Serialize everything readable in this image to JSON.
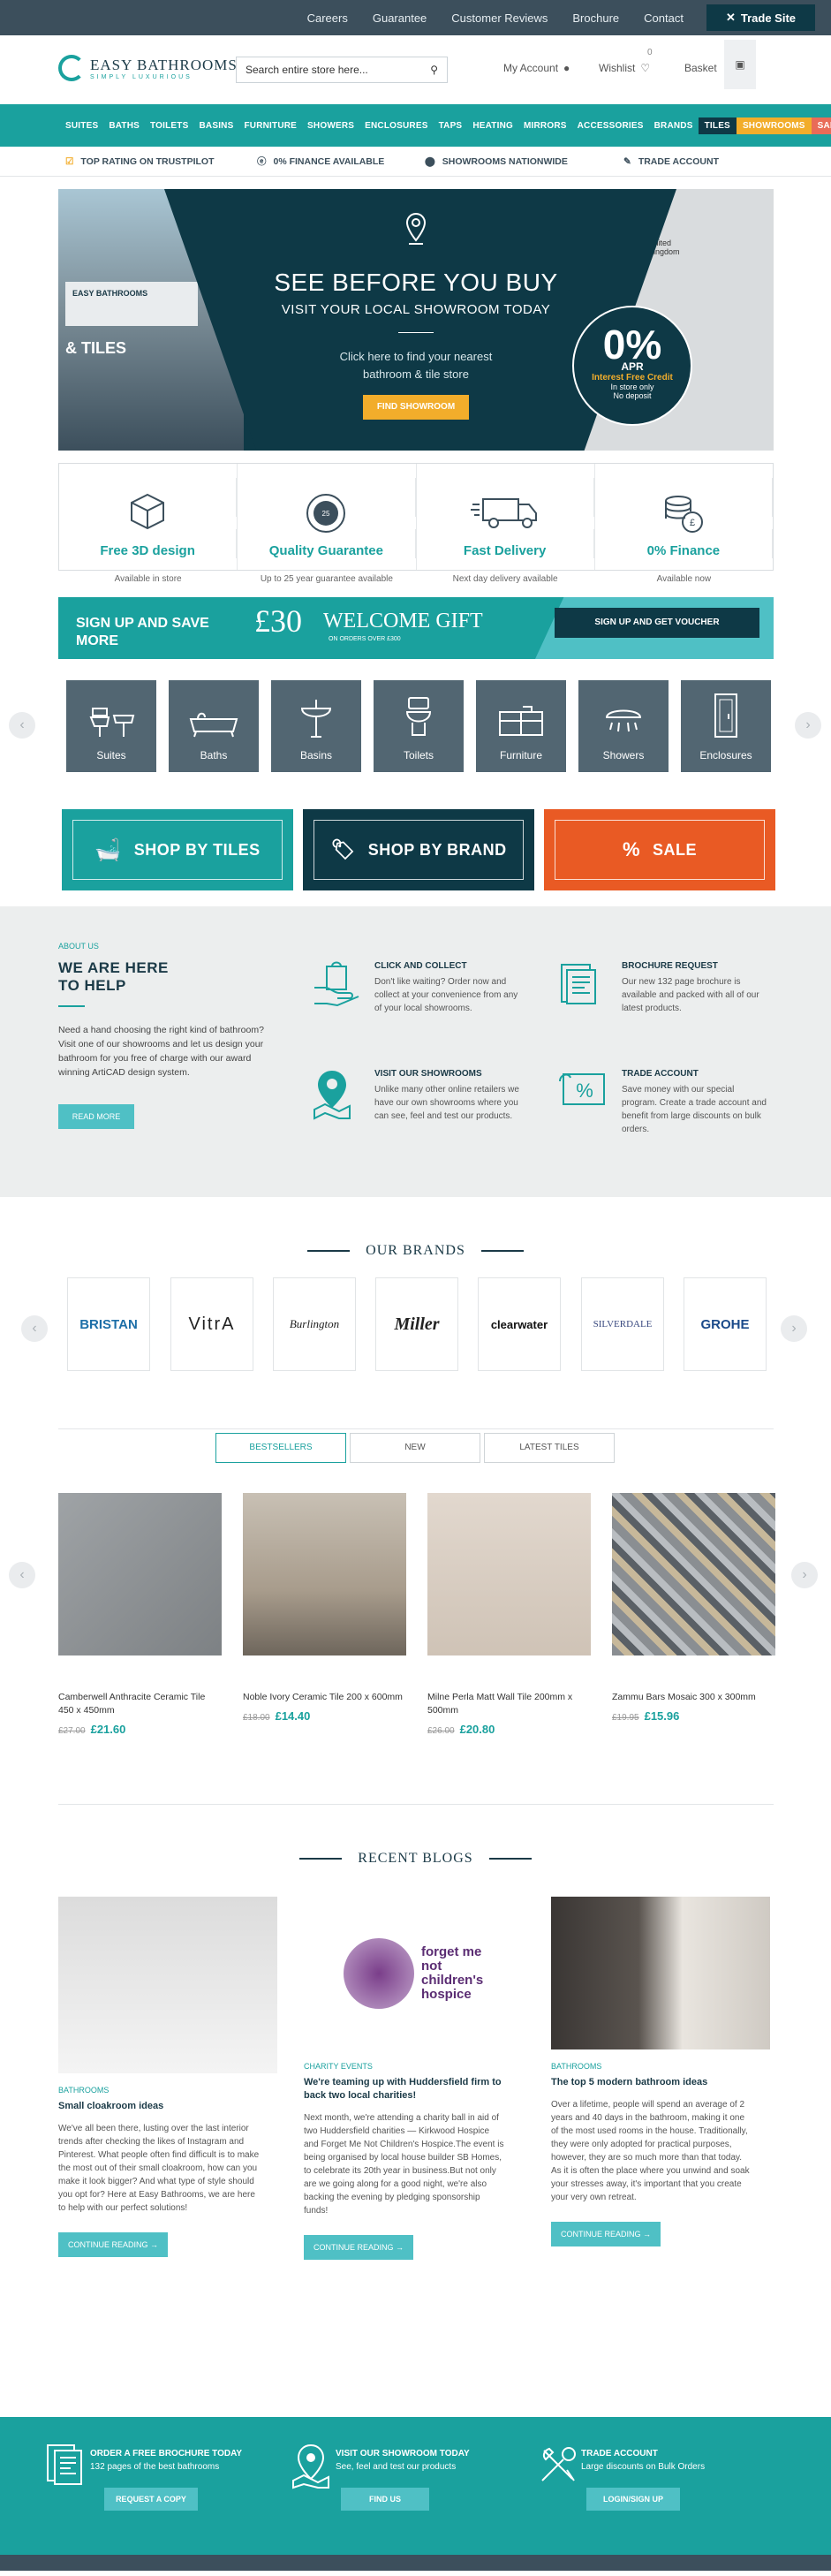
{
  "topbar": {
    "links": [
      "Careers",
      "Guarantee",
      "Customer Reviews",
      "Brochure",
      "Contact"
    ],
    "trade": "Trade Site"
  },
  "header": {
    "logo_line1": "EASY BATHROOMS",
    "logo_line2": "SIMPLY LUXURIOUS",
    "search_placeholder": "Search entire store here...",
    "account": "My Account",
    "wishlist": "Wishlist",
    "wishlist_count": "0",
    "basket": "Basket"
  },
  "nav": [
    "SUITES",
    "BATHS",
    "TOILETS",
    "BASINS",
    "FURNITURE",
    "SHOWERS",
    "ENCLOSURES",
    "TAPS",
    "HEATING",
    "MIRRORS",
    "ACCESSORIES",
    "BRANDS"
  ],
  "nav_special": {
    "tiles": "TILES",
    "showrooms": "SHOWROOMS",
    "sale": "SALE"
  },
  "usp": [
    "TOP RATING ON TRUSTPILOT",
    "0% FINANCE AVAILABLE",
    "SHOWROOMS NATIONWIDE",
    "TRADE ACCOUNT"
  ],
  "hero": {
    "title": "SEE BEFORE YOU BUY",
    "subtitle": "VISIT YOUR LOCAL SHOWROOM TODAY",
    "desc1": "Click here to find your nearest",
    "desc2": "bathroom & tile store",
    "cta": "FIND SHOWROOM",
    "shop_sign1": "EASY BATHROOMS",
    "shop_sign2": "& TILES",
    "apr_big": "0%",
    "apr_small": "APR",
    "apr_interest": "Interest Free Credit",
    "apr_l1": "In store only",
    "apr_l2": "No deposit",
    "map_label": "United Kingdom"
  },
  "features": [
    {
      "title": "Free 3D design",
      "sub": "Available in store"
    },
    {
      "title": "Quality Guarantee",
      "sub": "Up to 25 year guarantee available"
    },
    {
      "title": "Fast Delivery",
      "sub": "Next day delivery available"
    },
    {
      "title": "0% Finance",
      "sub": "Available now"
    }
  ],
  "gift": {
    "left1": "SIGN UP AND SAVE",
    "left2": "MORE",
    "amount": "£30",
    "word": "WELCOME GIFT",
    "min": "ON ORDERS OVER £300",
    "btn": "SIGN UP AND GET VOUCHER"
  },
  "categories": [
    "Suites",
    "Baths",
    "Basins",
    "Toilets",
    "Furniture",
    "Showers",
    "Enclosures"
  ],
  "shopby": [
    "SHOP BY TILES",
    "SHOP BY BRAND",
    "SALE"
  ],
  "about": {
    "label": "ABOUT US",
    "title1": "WE ARE HERE",
    "title2": "TO HELP",
    "text": "Need a hand choosing the right kind of bathroom? Visit one of our showrooms and let us design your bathroom for you free of charge with our award winning ArtiCAD design system.",
    "btn": "READ MORE",
    "items": [
      {
        "h": "CLICK AND COLLECT",
        "d": "Don't like waiting? Order now and collect at your convenience from any of your local showrooms."
      },
      {
        "h": "BROCHURE REQUEST",
        "d": "Our new 132 page brochure is available and packed with all of our latest products."
      },
      {
        "h": "VISIT OUR SHOWROOMS",
        "d": "Unlike many other online retailers we have our own showrooms where you can see, feel and test our products."
      },
      {
        "h": "TRADE ACCOUNT",
        "d": "Save money with our special program. Create a trade account and benefit from large discounts on bulk orders."
      }
    ]
  },
  "brands": {
    "heading": "OUR BRANDS",
    "items": [
      "BRISTAN",
      "VitrA",
      "Burlington",
      "Miller",
      "clearwater",
      "SILVERDALE",
      "GROHE"
    ]
  },
  "products": {
    "tabs": [
      "BESTSELLERS",
      "NEW",
      "LATEST TILES"
    ],
    "items": [
      {
        "name": "Camberwell Anthracite Ceramic Tile 450 x 450mm",
        "old": "£27.00",
        "price": "£21.60"
      },
      {
        "name": "Noble Ivory Ceramic Tile 200 x 600mm",
        "old": "£18.00",
        "price": "£14.40"
      },
      {
        "name": "Milne Perla Matt Wall Tile 200mm x 500mm",
        "old": "£26.00",
        "price": "£20.80"
      },
      {
        "name": "Zammu Bars Mosaic 300 x 300mm",
        "old": "£19.95",
        "price": "£15.96"
      }
    ]
  },
  "blogs": {
    "heading": "RECENT BLOGS",
    "items": [
      {
        "cat": "BATHROOMS",
        "title": "Small cloakroom ideas",
        "text": "We've all been there, lusting over the last interior trends after checking the likes of Instagram and Pinterest.  What people often find difficult is to make the most out of their small cloakroom, how can you make it look bigger? And what type of style should you opt for? Here at Easy Bathrooms, we are here to help with our perfect solutions!",
        "btn": "CONTINUE READING →"
      },
      {
        "cat": "CHARITY EVENTS",
        "title": "We're teaming up with Huddersfield firm to back two local charities!",
        "text": "Next month, we're attending a charity ball in aid of two Huddersfield charities — Kirkwood Hospice and Forget Me Not Children's Hospice.The event is being organised by local house builder SB Homes, to celebrate its 20th year in business.But not only are we going along for a good night, we're also backing the evening by pledging sponsorship funds!",
        "btn": "CONTINUE READING →",
        "image_text": "forget me not children's hospice"
      },
      {
        "cat": "BATHROOMS",
        "title": "The top 5 modern bathroom ideas",
        "text": "Over a lifetime, people will spend an average of 2 years and 40 days in the bathroom, making it one of the most used rooms in the house. Traditionally, they were only adopted for practical purposes, however, they are so much more than that today. As it is often the place where you unwind and soak your stresses away, it's important that you create your very own retreat.",
        "btn": "CONTINUE READING →"
      }
    ]
  },
  "footer": [
    {
      "h": "ORDER A FREE BROCHURE TODAY",
      "s": "132 pages of the best bathrooms",
      "b": "REQUEST A COPY"
    },
    {
      "h": "VISIT OUR SHOWROOM TODAY",
      "s": "See, feel and test our products",
      "b": "FIND US"
    },
    {
      "h": "TRADE ACCOUNT",
      "s": "Large discounts on Bulk Orders",
      "b": "LOGIN/SIGN UP"
    }
  ],
  "colors": {
    "teal": "#1aa19e",
    "navy": "#0e3946",
    "slate": "#3c4f5c",
    "amber": "#f2ad2b",
    "orange": "#e95a24"
  }
}
